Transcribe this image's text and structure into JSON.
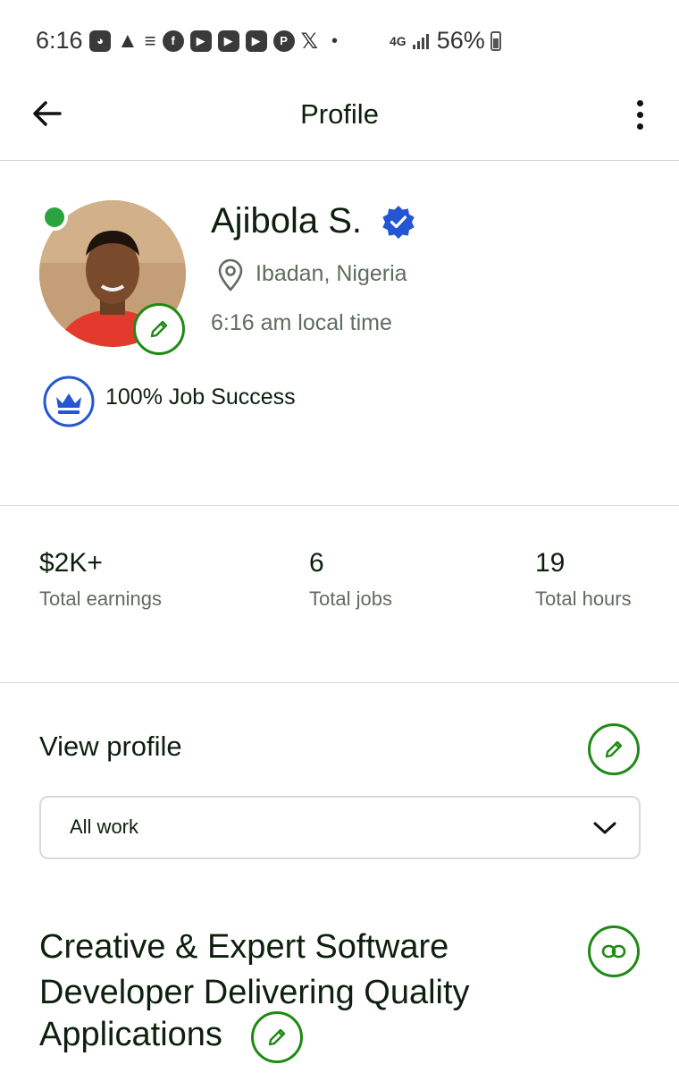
{
  "status_bar": {
    "time": "6:16",
    "network": "4G",
    "battery": "56%",
    "notification_icons": [
      "discord-icon",
      "warning-icon",
      "playlist-icon",
      "facebook-icon",
      "youtube-icon",
      "youtube-icon",
      "youtube-icon",
      "pinterest-icon",
      "x-icon"
    ]
  },
  "app_bar": {
    "title": "Profile"
  },
  "profile": {
    "name": "Ajibola S.",
    "location": "Ibadan, Nigeria",
    "local_time": "6:16 am local time",
    "job_success": "100% Job Success",
    "online": true
  },
  "stats": [
    {
      "value": "$2K+",
      "label": "Total earnings"
    },
    {
      "value": "6",
      "label": "Total jobs"
    },
    {
      "value": "19",
      "label": "Total hours"
    }
  ],
  "view_profile": {
    "title": "View profile",
    "selected_option": "All work"
  },
  "headline": {
    "line1": "Creative & Expert Software",
    "line2": "Developer Delivering Quality",
    "line3": "Applications"
  },
  "colors": {
    "accent_green": "#1e8a14",
    "verified_blue": "#2456d3",
    "online_green": "#2aa341",
    "text_primary": "#0d1f0d",
    "text_secondary": "#5e6d5e"
  }
}
